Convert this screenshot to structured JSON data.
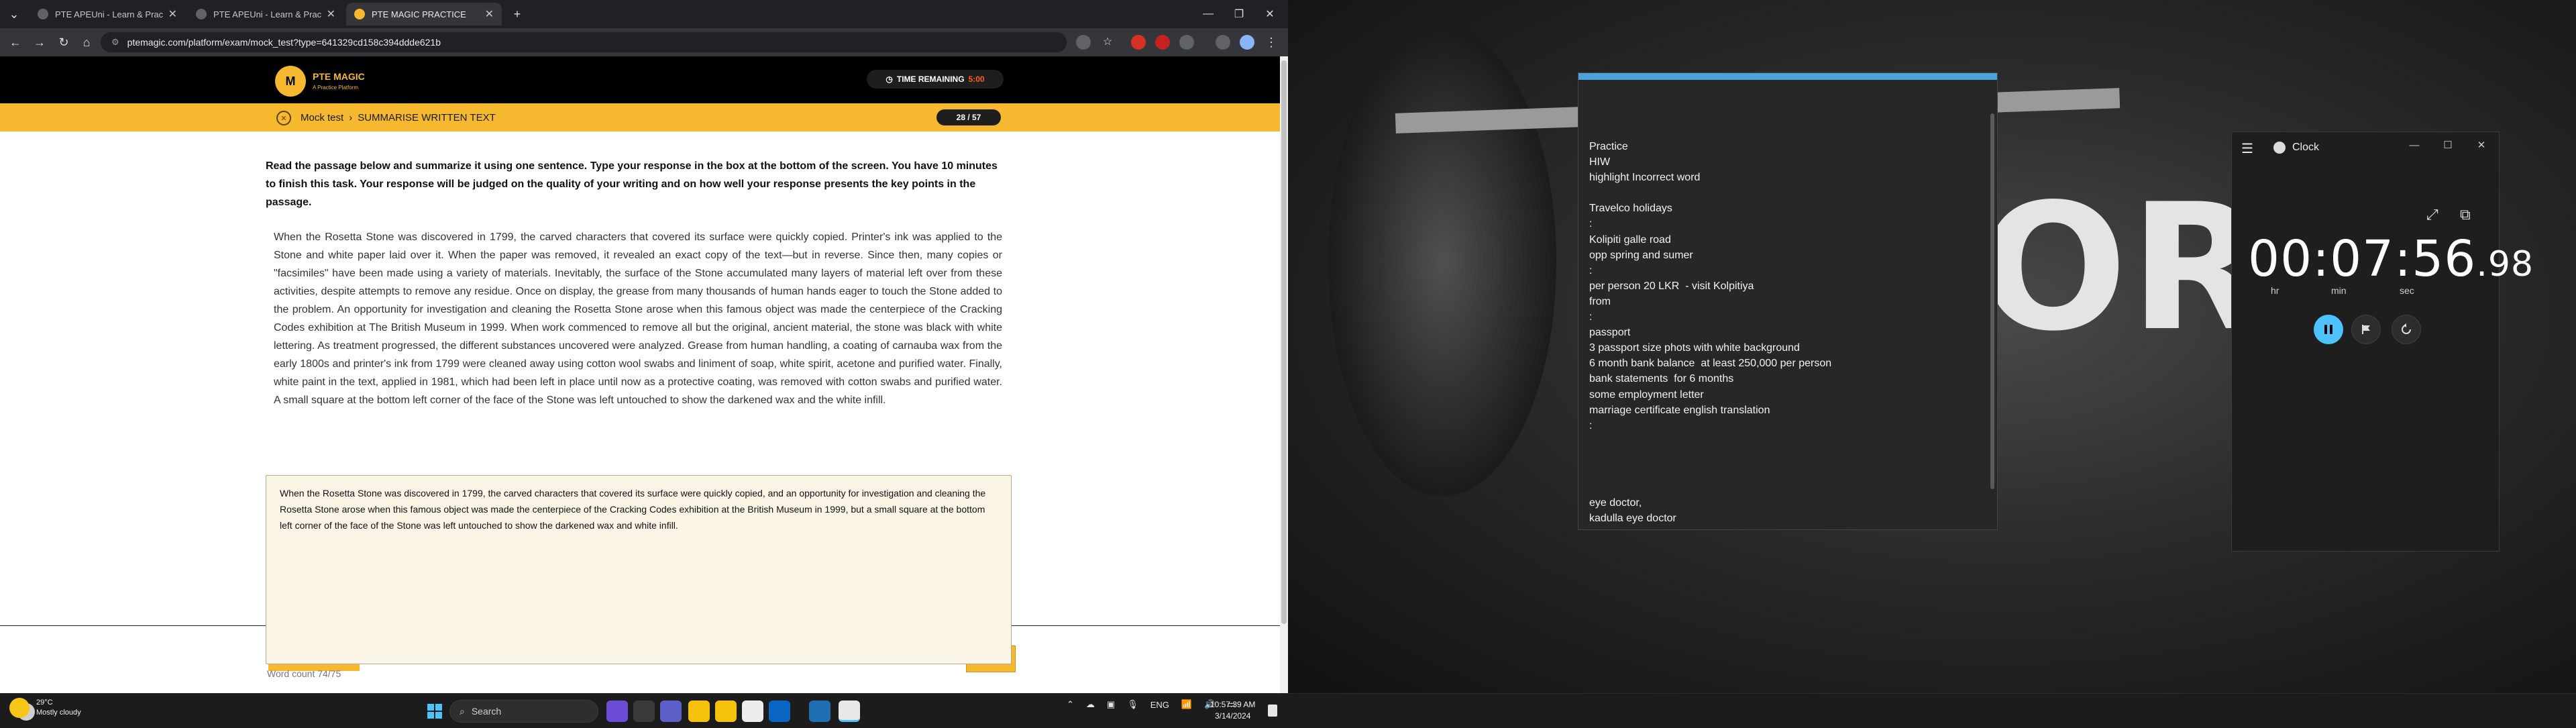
{
  "browser": {
    "tabs": [
      {
        "title": "PTE APEUni - Learn & Practice"
      },
      {
        "title": "PTE APEUni - Learn & Practice"
      },
      {
        "title": "PTE MAGIC PRACTICE"
      }
    ],
    "url": "ptemagic.com/platform/exam/mock_test?type=641329cd158c394ddde621b"
  },
  "site": {
    "brand": "PTE MAGIC",
    "tagline": "A Practice Platform",
    "timer_label": "TIME REMAINING",
    "timer_value": "5:00",
    "breadcrumb_root": "Mock test",
    "breadcrumb_sep": "›",
    "breadcrumb_page": "SUMMARISE WRITTEN TEXT",
    "question_counter": "28 / 57",
    "instructions": "Read the passage below and summarize it using one sentence. Type your response in the box at the bottom of the screen. You have 10 minutes to finish this task. Your response will be judged on the quality of your writing and on how well your response presents the key points in the passage.",
    "passage": "When the Rosetta Stone was discovered in 1799, the carved characters that covered its surface were quickly copied. Printer's ink was applied to the Stone and white paper laid over it. When the paper was removed, it revealed an exact copy of the text—but in reverse. Since then, many copies or \"facsimiles\" have been made using a variety of materials. Inevitably, the surface of the Stone accumulated many layers of material left over from these activities, despite attempts to remove any residue. Once on display, the grease from many thousands of human hands eager to touch the Stone added to the problem. An opportunity for investigation and cleaning the Rosetta Stone arose when this famous object was made the centerpiece of the Cracking Codes exhibition at The British Museum in 1999. When work commenced to remove all but the original, ancient material, the stone was black with white lettering. As treatment progressed, the different substances uncovered were analyzed. Grease from human handling, a coating of carnauba wax from the early 1800s and printer's ink from 1799 were cleaned away using cotton wool swabs and liniment of soap, white spirit, acetone and purified water. Finally, white paint in the text, applied in 1981, which had been left in place until now as a protective coating, was removed with cotton swabs and purified water. A small square at the bottom left corner of the face of the Stone was left untouched to show the darkened wax and the white infill.",
    "response": "When the Rosetta Stone was discovered in 1799, the carved characters that covered its surface were quickly copied, and an opportunity for investigation and cleaning the Rosetta Stone arose when this famous object was made the centerpiece of the Cracking Codes exhibition at the British Museum in 1999, but a small square at the bottom left corner of the face of the Stone was left untouched to show the darkened wax and white infill.",
    "word_count": "Word count 74/75"
  },
  "notepad": {
    "text": "Practice\nHIW\nhighlight Incorrect word\n\nTravelco holidays\n:\nKolipiti galle road\nopp spring and sumer\n:\nper person 20 LKR  - visit Kolpitiya\nfrom\n:\npassport\n3 passport size phots with white background\n6 month bank balance  at least 250,000 per person\nbank statements  for 6 months\nsome employment letter\nmarriage certificate english translation\n:\n\n\n\n\neye doctor,\nkadulla eye doctor"
  },
  "wallpaper_text": "ORI",
  "clock_app": {
    "title": "Clock",
    "time_main": "00:07:56",
    "time_frac": ".98",
    "units": [
      "hr",
      "min",
      "sec"
    ]
  },
  "taskbar": {
    "weather_temp": "29°C",
    "weather_desc": "Mostly cloudy",
    "search_placeholder": "Search",
    "lang": "ENG",
    "time": "10:57:39 AM",
    "date": "3/14/2024"
  }
}
